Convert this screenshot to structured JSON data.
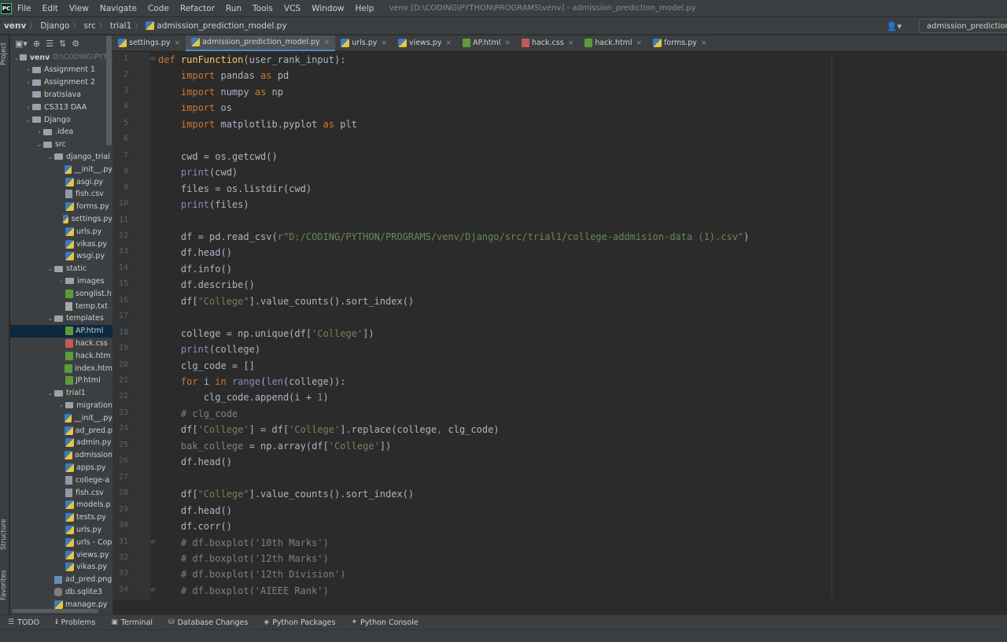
{
  "app": {
    "logo_text": "PC",
    "window_title": "venv [D:\\CODING\\PYTHON\\PROGRAMS\\venv] - admission_prediction_model.py"
  },
  "menu": [
    "File",
    "Edit",
    "View",
    "Navigate",
    "Code",
    "Refactor",
    "Run",
    "Tools",
    "VCS",
    "Window",
    "Help"
  ],
  "breadcrumb": [
    "venv",
    "Django",
    "src",
    "trial1",
    "admission_prediction_model.py"
  ],
  "run_config": "admission_prediction",
  "side_labels": {
    "project": "Project",
    "structure": "Structure",
    "favorites": "Favorites"
  },
  "tabs": [
    {
      "label": "settings.py",
      "icon": "python-file-icon",
      "active": false
    },
    {
      "label": "admission_prediction_model.py",
      "icon": "python-file-icon",
      "active": true
    },
    {
      "label": "urls.py",
      "icon": "python-file-icon",
      "active": false
    },
    {
      "label": "views.py",
      "icon": "python-file-icon",
      "active": false
    },
    {
      "label": "AP.html",
      "icon": "html-file-icon",
      "active": false
    },
    {
      "label": "hack.css",
      "icon": "css-file-icon",
      "active": false
    },
    {
      "label": "hack.html",
      "icon": "html-file-icon",
      "active": false
    },
    {
      "label": "forms.py",
      "icon": "python-file-icon",
      "active": false
    }
  ],
  "tree": [
    {
      "depth": 0,
      "arrow": "open",
      "icon": "folder",
      "label": "venv",
      "extra": "D:\\CODING\\PYTH"
    },
    {
      "depth": 1,
      "arrow": "closed",
      "icon": "folder",
      "label": "Assignment 1"
    },
    {
      "depth": 1,
      "arrow": "closed",
      "icon": "folder",
      "label": "Assignment 2"
    },
    {
      "depth": 1,
      "arrow": "none",
      "icon": "folder",
      "label": "bratislava"
    },
    {
      "depth": 1,
      "arrow": "closed",
      "icon": "folder",
      "label": "CS313 DAA"
    },
    {
      "depth": 1,
      "arrow": "open",
      "icon": "folder",
      "label": "Django"
    },
    {
      "depth": 2,
      "arrow": "closed",
      "icon": "folder",
      "label": ".idea"
    },
    {
      "depth": 2,
      "arrow": "open",
      "icon": "folder",
      "label": "src"
    },
    {
      "depth": 3,
      "arrow": "open",
      "icon": "folder",
      "label": "django_trial"
    },
    {
      "depth": 4,
      "arrow": "none",
      "icon": "py",
      "label": "__init__.py"
    },
    {
      "depth": 4,
      "arrow": "none",
      "icon": "py",
      "label": "asgi.py"
    },
    {
      "depth": 4,
      "arrow": "none",
      "icon": "csv",
      "label": "fish.csv"
    },
    {
      "depth": 4,
      "arrow": "none",
      "icon": "py",
      "label": "forms.py"
    },
    {
      "depth": 4,
      "arrow": "none",
      "icon": "py",
      "label": "settings.py"
    },
    {
      "depth": 4,
      "arrow": "none",
      "icon": "py",
      "label": "urls.py"
    },
    {
      "depth": 4,
      "arrow": "none",
      "icon": "py",
      "label": "vikas.py"
    },
    {
      "depth": 4,
      "arrow": "none",
      "icon": "py",
      "label": "wsgi.py"
    },
    {
      "depth": 3,
      "arrow": "open",
      "icon": "folder",
      "label": "static"
    },
    {
      "depth": 4,
      "arrow": "closed",
      "icon": "folder",
      "label": "images"
    },
    {
      "depth": 4,
      "arrow": "none",
      "icon": "html",
      "label": "songlist.h"
    },
    {
      "depth": 4,
      "arrow": "none",
      "icon": "txt",
      "label": "temp.txt"
    },
    {
      "depth": 3,
      "arrow": "open",
      "icon": "folder",
      "label": "templates"
    },
    {
      "depth": 4,
      "arrow": "none",
      "icon": "html",
      "label": "AP.html",
      "selected": true
    },
    {
      "depth": 4,
      "arrow": "none",
      "icon": "css",
      "label": "hack.css"
    },
    {
      "depth": 4,
      "arrow": "none",
      "icon": "html",
      "label": "hack.htm"
    },
    {
      "depth": 4,
      "arrow": "none",
      "icon": "html",
      "label": "index.htm"
    },
    {
      "depth": 4,
      "arrow": "none",
      "icon": "html",
      "label": "JP.html"
    },
    {
      "depth": 3,
      "arrow": "open",
      "icon": "folder",
      "label": "trial1"
    },
    {
      "depth": 4,
      "arrow": "closed",
      "icon": "folder",
      "label": "migration"
    },
    {
      "depth": 4,
      "arrow": "none",
      "icon": "py",
      "label": "__init__.py"
    },
    {
      "depth": 4,
      "arrow": "none",
      "icon": "py",
      "label": "ad_pred.p"
    },
    {
      "depth": 4,
      "arrow": "none",
      "icon": "py",
      "label": "admin.py"
    },
    {
      "depth": 4,
      "arrow": "none",
      "icon": "py",
      "label": "admission"
    },
    {
      "depth": 4,
      "arrow": "none",
      "icon": "py",
      "label": "apps.py"
    },
    {
      "depth": 4,
      "arrow": "none",
      "icon": "csv",
      "label": "college-a"
    },
    {
      "depth": 4,
      "arrow": "none",
      "icon": "csv",
      "label": "fish.csv"
    },
    {
      "depth": 4,
      "arrow": "none",
      "icon": "py",
      "label": "models.p"
    },
    {
      "depth": 4,
      "arrow": "none",
      "icon": "py",
      "label": "tests.py"
    },
    {
      "depth": 4,
      "arrow": "none",
      "icon": "py",
      "label": "urls.py"
    },
    {
      "depth": 4,
      "arrow": "none",
      "icon": "py",
      "label": "urls - Cop"
    },
    {
      "depth": 4,
      "arrow": "none",
      "icon": "py",
      "label": "views.py"
    },
    {
      "depth": 4,
      "arrow": "none",
      "icon": "py",
      "label": "vikas.py"
    },
    {
      "depth": 3,
      "arrow": "none",
      "icon": "png",
      "label": "ad_pred.png"
    },
    {
      "depth": 3,
      "arrow": "none",
      "icon": "db",
      "label": "db.sqlite3"
    },
    {
      "depth": 3,
      "arrow": "none",
      "icon": "py",
      "label": "manage.py"
    }
  ],
  "code_lines": [
    [
      [
        "kw",
        "def "
      ],
      [
        "fn",
        "runFunction"
      ],
      [
        "t",
        "(user_rank_input):"
      ]
    ],
    [
      [
        "t",
        "    "
      ],
      [
        "kw",
        "import "
      ],
      [
        "t",
        "pandas "
      ],
      [
        "kw",
        "as "
      ],
      [
        "t",
        "pd"
      ]
    ],
    [
      [
        "t",
        "    "
      ],
      [
        "kw",
        "import "
      ],
      [
        "t",
        "numpy "
      ],
      [
        "kw",
        "as "
      ],
      [
        "t",
        "np"
      ]
    ],
    [
      [
        "t",
        "    "
      ],
      [
        "kw",
        "import "
      ],
      [
        "t",
        "os"
      ]
    ],
    [
      [
        "t",
        "    "
      ],
      [
        "kw",
        "import "
      ],
      [
        "t",
        "matplotlib.pyplot "
      ],
      [
        "kw",
        "as "
      ],
      [
        "t",
        "plt"
      ]
    ],
    [
      [
        "t",
        ""
      ]
    ],
    [
      [
        "t",
        "    cwd = os.getcwd()"
      ]
    ],
    [
      [
        "t",
        "    "
      ],
      [
        "bi",
        "print"
      ],
      [
        "t",
        "(cwd)"
      ]
    ],
    [
      [
        "t",
        "    files = os.listdir(cwd)"
      ]
    ],
    [
      [
        "t",
        "    "
      ],
      [
        "bi",
        "print"
      ],
      [
        "t",
        "(files)"
      ]
    ],
    [
      [
        "t",
        ""
      ]
    ],
    [
      [
        "t",
        "    df = pd.read_csv("
      ],
      [
        "str",
        "r\"D:/CODING/PYTHON/PROGRAMS/venv/Django/src/trial1/college-addmision-data (1).csv\""
      ],
      [
        "t",
        ")"
      ]
    ],
    [
      [
        "t",
        "    df.head()"
      ]
    ],
    [
      [
        "t",
        "    df.info()"
      ]
    ],
    [
      [
        "t",
        "    df.describe()"
      ]
    ],
    [
      [
        "t",
        "    df["
      ],
      [
        "str",
        "\"College\""
      ],
      [
        "t",
        "].value_counts().sort_index()"
      ]
    ],
    [
      [
        "t",
        ""
      ]
    ],
    [
      [
        "t",
        "    college = np.unique(df["
      ],
      [
        "str",
        "'College'"
      ],
      [
        "t",
        "])"
      ]
    ],
    [
      [
        "t",
        "    "
      ],
      [
        "bi",
        "print"
      ],
      [
        "t",
        "(college)"
      ]
    ],
    [
      [
        "t",
        "    clg_code = []"
      ]
    ],
    [
      [
        "t",
        "    "
      ],
      [
        "kw",
        "for "
      ],
      [
        "t",
        "i "
      ],
      [
        "kw",
        "in "
      ],
      [
        "bi",
        "range"
      ],
      [
        "t",
        "("
      ],
      [
        "bi",
        "len"
      ],
      [
        "t",
        "(college)):"
      ]
    ],
    [
      [
        "t",
        "        clg_code.append(i + "
      ],
      [
        "num",
        "1"
      ],
      [
        "t",
        ")"
      ]
    ],
    [
      [
        "cm",
        "    # clg_code"
      ]
    ],
    [
      [
        "t",
        "    df["
      ],
      [
        "str",
        "'College'"
      ],
      [
        "t",
        "] = df["
      ],
      [
        "str",
        "'College'"
      ],
      [
        "t",
        "].replace(college"
      ],
      [
        "kw",
        ","
      ],
      [
        "t",
        " clg_code)"
      ]
    ],
    [
      [
        "cm",
        "    bak_college"
      ],
      [
        "t",
        " = np.array(df["
      ],
      [
        "str",
        "'College'"
      ],
      [
        "t",
        "])"
      ]
    ],
    [
      [
        "t",
        "    df.head()"
      ]
    ],
    [
      [
        "t",
        ""
      ]
    ],
    [
      [
        "t",
        "    df["
      ],
      [
        "str",
        "\"College\""
      ],
      [
        "t",
        "].value_counts().sort_index()"
      ]
    ],
    [
      [
        "t",
        "    df.head()"
      ]
    ],
    [
      [
        "t",
        "    df.corr()"
      ]
    ],
    [
      [
        "cm",
        "    # df.boxplot('10th Marks')"
      ]
    ],
    [
      [
        "cm",
        "    # df.boxplot('12th Marks')"
      ]
    ],
    [
      [
        "cm",
        "    # df.boxplot('12th Division')"
      ]
    ],
    [
      [
        "cm",
        "    # df.boxplot('AIEEE Rank')"
      ]
    ]
  ],
  "bottom_tools": [
    {
      "label": "TODO",
      "icon": "list-icon"
    },
    {
      "label": "Problems",
      "icon": "info-icon"
    },
    {
      "label": "Terminal",
      "icon": "terminal-icon"
    },
    {
      "label": "Database Changes",
      "icon": "database-icon"
    },
    {
      "label": "Python Packages",
      "icon": "packages-icon"
    },
    {
      "label": "Python Console",
      "icon": "python-console-icon"
    }
  ]
}
